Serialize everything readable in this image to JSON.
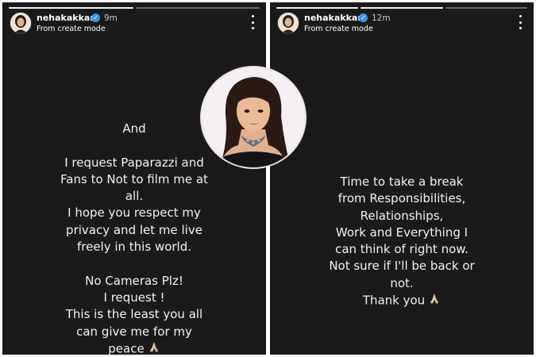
{
  "left_story": {
    "username": "nehakakkar",
    "time": "9m",
    "subtitle": "From create mode",
    "paragraphs": [
      [
        "And"
      ],
      [
        "I request Paparazzi and",
        "Fans to Not to film me at",
        "all.",
        "I hope you respect my",
        "privacy and let me live",
        "freely in this world."
      ],
      [
        "No Cameras Plz!",
        "I request !",
        "This is the least you all",
        "can give me for my",
        "peace"
      ]
    ],
    "end_emoji": "folded-hands-icon"
  },
  "right_story": {
    "username": "nehakakkar",
    "time": "12m",
    "subtitle": "From create mode",
    "lines": [
      "Time to take a break",
      "from Responsibilities,",
      "Relationships,",
      "Work and Everything I",
      "can think of right now.",
      "Not sure if I'll be back or",
      "not.",
      "Thank you"
    ],
    "end_emoji": "folded-hands-icon"
  },
  "colors": {
    "story_bg": "#1a1a1a",
    "text": "#f2f2f2",
    "verified": "#3897f0",
    "page_bg": "#ffffff"
  }
}
